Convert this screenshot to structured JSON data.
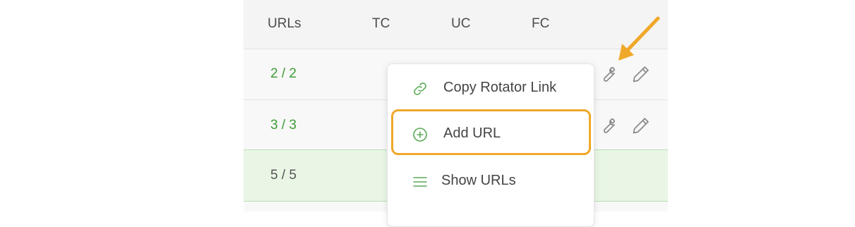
{
  "table": {
    "headers": [
      "URLs",
      "TC",
      "UC",
      "FC"
    ],
    "rows": [
      {
        "urls": "2 / 2"
      },
      {
        "urls": "3 / 3"
      },
      {
        "urls": "5 / 5"
      }
    ],
    "row_actions": [
      "wrench-icon",
      "pencil-icon"
    ]
  },
  "menu": {
    "items": [
      {
        "label": "Copy Rotator Link",
        "icon": "link-icon"
      },
      {
        "label": "Add URL",
        "icon": "plus-circle-icon",
        "highlighted": true
      },
      {
        "label": "Show URLs",
        "icon": "list-icon"
      }
    ]
  },
  "annotation": {
    "arrow_icon": "callout-arrow-icon",
    "highlight_color": "#f0a82a"
  },
  "colors": {
    "accent_green": "#3d9b35",
    "highlight_orange": "#f0a82a",
    "selected_row_bg": "#e9f6e6"
  }
}
